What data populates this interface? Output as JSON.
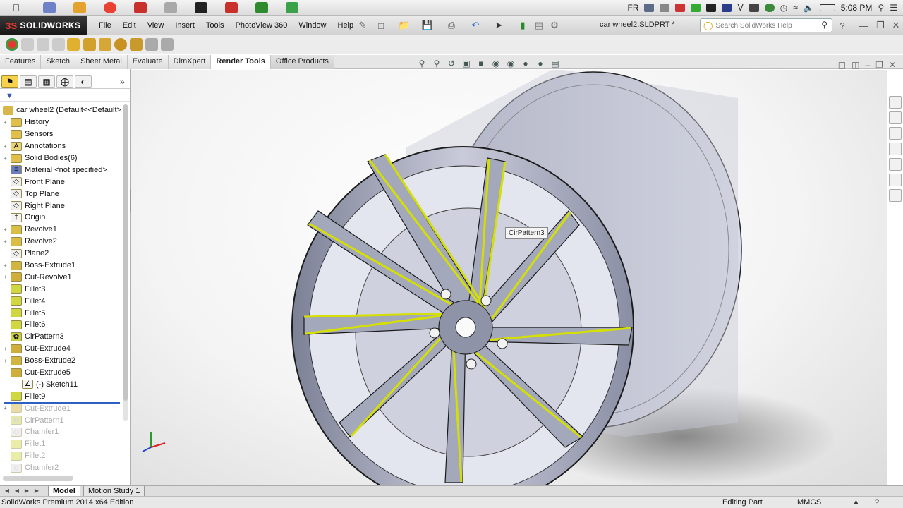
{
  "mac_menubar": {
    "input_source": "FR",
    "clock": "5:08 PM"
  },
  "app": {
    "name": "SOLIDWORKS",
    "menus": [
      "File",
      "Edit",
      "View",
      "Insert",
      "Tools",
      "PhotoView 360",
      "Window",
      "Help"
    ],
    "document_title": "car wheel2.SLDPRT *",
    "search_placeholder": "Search SolidWorks Help"
  },
  "command_tabs": [
    {
      "label": "Features",
      "active": false
    },
    {
      "label": "Sketch",
      "active": false
    },
    {
      "label": "Sheet Metal",
      "active": false
    },
    {
      "label": "Evaluate",
      "active": false
    },
    {
      "label": "DimXpert",
      "active": false
    },
    {
      "label": "Render Tools",
      "active": true
    },
    {
      "label": "Office Products",
      "active": false
    }
  ],
  "feature_tree": {
    "root_label": "car wheel2  (Default<<Default>",
    "items": [
      {
        "label": "History",
        "icon": "history-folder-icon",
        "expandable": true
      },
      {
        "label": "Sensors",
        "icon": "sensors-folder-icon",
        "expandable": false
      },
      {
        "label": "Annotations",
        "icon": "annotations-icon",
        "expandable": true
      },
      {
        "label": "Solid Bodies(6)",
        "icon": "solid-bodies-folder-icon",
        "expandable": true
      },
      {
        "label": "Material <not specified>",
        "icon": "material-icon",
        "expandable": false
      },
      {
        "label": "Front Plane",
        "icon": "plane-icon",
        "expandable": false
      },
      {
        "label": "Top Plane",
        "icon": "plane-icon",
        "expandable": false
      },
      {
        "label": "Right Plane",
        "icon": "plane-icon",
        "expandable": false
      },
      {
        "label": "Origin",
        "icon": "origin-icon",
        "expandable": false
      },
      {
        "label": "Revolve1",
        "icon": "revolve-icon",
        "expandable": true
      },
      {
        "label": "Revolve2",
        "icon": "revolve-icon",
        "expandable": true
      },
      {
        "label": "Plane2",
        "icon": "plane-icon",
        "expandable": false
      },
      {
        "label": "Boss-Extrude1",
        "icon": "extrude-icon",
        "expandable": true
      },
      {
        "label": "Cut-Revolve1",
        "icon": "cut-revolve-icon",
        "expandable": true
      },
      {
        "label": "Fillet3",
        "icon": "fillet-icon",
        "expandable": false
      },
      {
        "label": "Fillet4",
        "icon": "fillet-icon",
        "expandable": false
      },
      {
        "label": "Fillet5",
        "icon": "fillet-icon",
        "expandable": false
      },
      {
        "label": "Fillet6",
        "icon": "fillet-icon",
        "expandable": false
      },
      {
        "label": "CirPattern3",
        "icon": "circular-pattern-icon",
        "expandable": false
      },
      {
        "label": "Cut-Extrude4",
        "icon": "cut-extrude-icon",
        "expandable": true
      },
      {
        "label": "Boss-Extrude2",
        "icon": "extrude-icon",
        "expandable": true
      },
      {
        "label": "Cut-Extrude5",
        "icon": "cut-extrude-icon",
        "expandable": true,
        "expanded": true
      },
      {
        "label": "(-) Sketch11",
        "icon": "sketch-icon",
        "expandable": false,
        "child": true
      },
      {
        "label": "Fillet9",
        "icon": "fillet-icon",
        "expandable": false
      },
      {
        "label": "Cut-Extrude1",
        "icon": "cut-extrude-icon",
        "expandable": true,
        "suppressed": true
      },
      {
        "label": "CirPattern1",
        "icon": "circular-pattern-icon",
        "expandable": false,
        "suppressed": true
      },
      {
        "label": "Chamfer1",
        "icon": "chamfer-icon",
        "expandable": false,
        "suppressed": true
      },
      {
        "label": "Fillet1",
        "icon": "fillet-icon",
        "expandable": false,
        "suppressed": true
      },
      {
        "label": "Fillet2",
        "icon": "fillet-icon",
        "expandable": false,
        "suppressed": true
      },
      {
        "label": "Chamfer2",
        "icon": "chamfer-icon",
        "expandable": false,
        "suppressed": true
      }
    ]
  },
  "viewport": {
    "tooltip": "CirPattern3"
  },
  "bottom_tabs": [
    {
      "label": "Model",
      "active": true
    },
    {
      "label": "Motion Study 1",
      "active": false
    }
  ],
  "status_bar": {
    "edition": "SolidWorks Premium 2014 x64 Edition",
    "mode": "Editing Part",
    "units": "MMGS"
  },
  "colors": {
    "selection_highlight": "#d6e000",
    "wheel_metal": "#9fa3b8",
    "rollback_bar": "#2e5fc3"
  }
}
